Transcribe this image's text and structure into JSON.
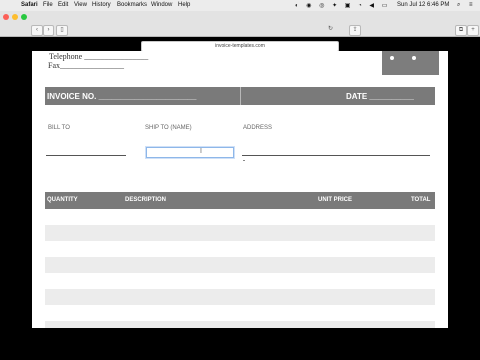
{
  "menubar": {
    "apple": "",
    "items": [
      "Safari",
      "File",
      "Edit",
      "View",
      "History",
      "Bookmarks",
      "Window",
      "Help"
    ],
    "clock": "Sun Jul 12  6:46 PM"
  },
  "browser": {
    "url": "invoice-templates.com"
  },
  "doc": {
    "telephone": "Telephone ________________",
    "fax": "Fax________________",
    "invoice_no": "INVOICE NO. ______________________",
    "date": "DATE __________",
    "bill_to": "BILL TO",
    "ship_to": "SHIP TO (NAME)",
    "address": "ADDRESS",
    "caret": "I",
    "table": {
      "quantity": "QUANTITY",
      "description": "DESCRIPTION",
      "unit_price": "UNIT PRICE",
      "total": "TOTAL"
    }
  }
}
